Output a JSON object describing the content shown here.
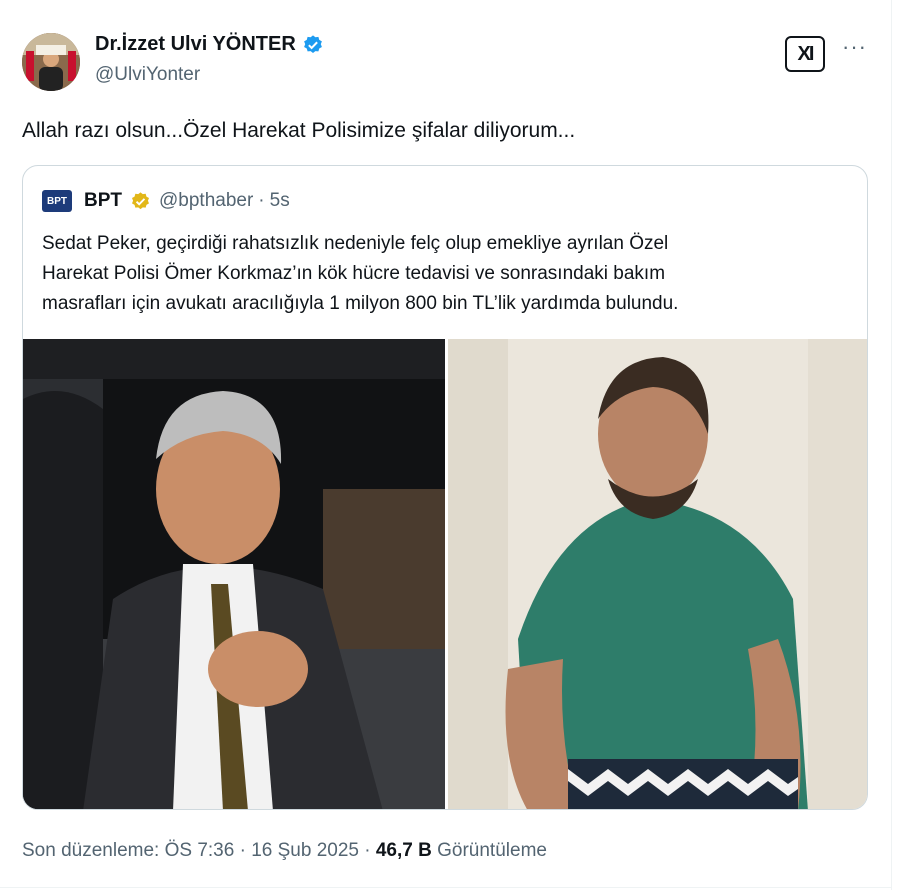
{
  "author": {
    "name": "Dr.İzzet Ulvi YÖNTER",
    "handle": "@UlviYonter",
    "verified_color": "#1d9bf0",
    "avatar_icon": "avatar-photo"
  },
  "header_actions": {
    "grok_label": "XI",
    "more_label": "···"
  },
  "tweet": {
    "text": "Allah razı olsun...Özel Harekat Polisimize şifalar diliyorum..."
  },
  "quote": {
    "logo_text": "BPT",
    "name": "BPT",
    "handle": "@bpthaber",
    "separator": "·",
    "time": "5s",
    "verified_color": "#e2b719",
    "lines": [
      "Sedat Peker, geçirdiği rahatsızlık nedeniyle felç olup emekliye ayrılan Özel",
      "Harekat Polisi Ömer Korkmaz’ın kök hücre tedavisi ve sonrasındaki bakım",
      "masrafları için avukatı aracılığıyla 1 milyon 800 bin TL’lik yardımda bulundu."
    ]
  },
  "meta": {
    "edited_label": "Son düzenleme: ÖS 7:36",
    "sep1": " · ",
    "date": "16 Şub 2025",
    "sep2": " · ",
    "views_count": "46,7 B",
    "views_label": "Görüntüleme"
  }
}
